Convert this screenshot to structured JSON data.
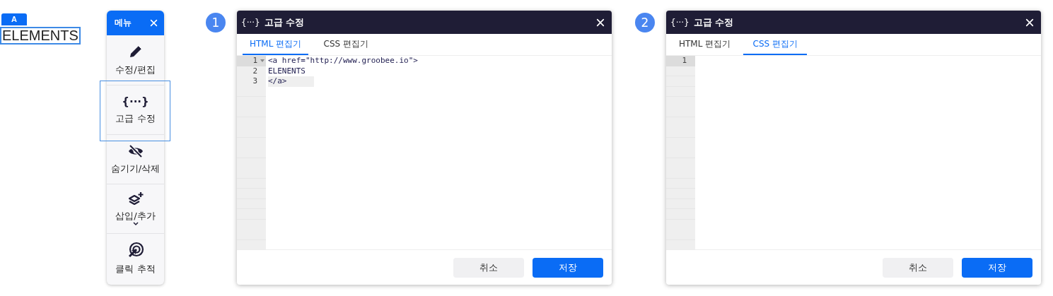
{
  "element_label": {
    "tag": "A",
    "text": "ELEMENTS"
  },
  "menu": {
    "title": "메뉴",
    "items": [
      {
        "label": "수정/편집",
        "selected": false,
        "submenu": false
      },
      {
        "label": "고급 수정",
        "glyph": "{···}",
        "selected": true,
        "submenu": false
      },
      {
        "label": "숨기기/삭제",
        "selected": false,
        "submenu": false
      },
      {
        "label": "삽입/추가",
        "selected": false,
        "submenu": true
      },
      {
        "label": "클릭 추적",
        "selected": false,
        "submenu": false
      }
    ]
  },
  "dialogs": [
    {
      "badge": "1",
      "title_icon": "{···}",
      "title": "고급 수정",
      "tabs": [
        {
          "label": "HTML 편집기",
          "selected": true
        },
        {
          "label": "CSS 편집기",
          "selected": false
        }
      ],
      "lines": [
        {
          "number": "1",
          "text": "<a href=\"http://www.groobee.io\">",
          "foldable": true,
          "gutter_selected": true,
          "highlighted": false
        },
        {
          "number": "2",
          "text": "ELENENTS",
          "foldable": false,
          "gutter_selected": false,
          "highlighted": false
        },
        {
          "number": "3",
          "text": "</a>",
          "foldable": false,
          "gutter_selected": false,
          "highlighted": true
        }
      ],
      "buttons": [
        {
          "label": "취소",
          "kind": "secondary"
        },
        {
          "label": "저장",
          "kind": "primary"
        }
      ]
    },
    {
      "badge": "2",
      "title_icon": "{···}",
      "title": "고급 수정",
      "tabs": [
        {
          "label": "HTML 편집기",
          "selected": false
        },
        {
          "label": "CSS 편집기",
          "selected": true
        }
      ],
      "lines": [
        {
          "number": "1",
          "foldable": false,
          "gutter_selected": true,
          "highlighted": false
        }
      ],
      "buttons": [
        {
          "label": "취소",
          "kind": "secondary"
        },
        {
          "label": "저장",
          "kind": "primary"
        }
      ]
    }
  ]
}
